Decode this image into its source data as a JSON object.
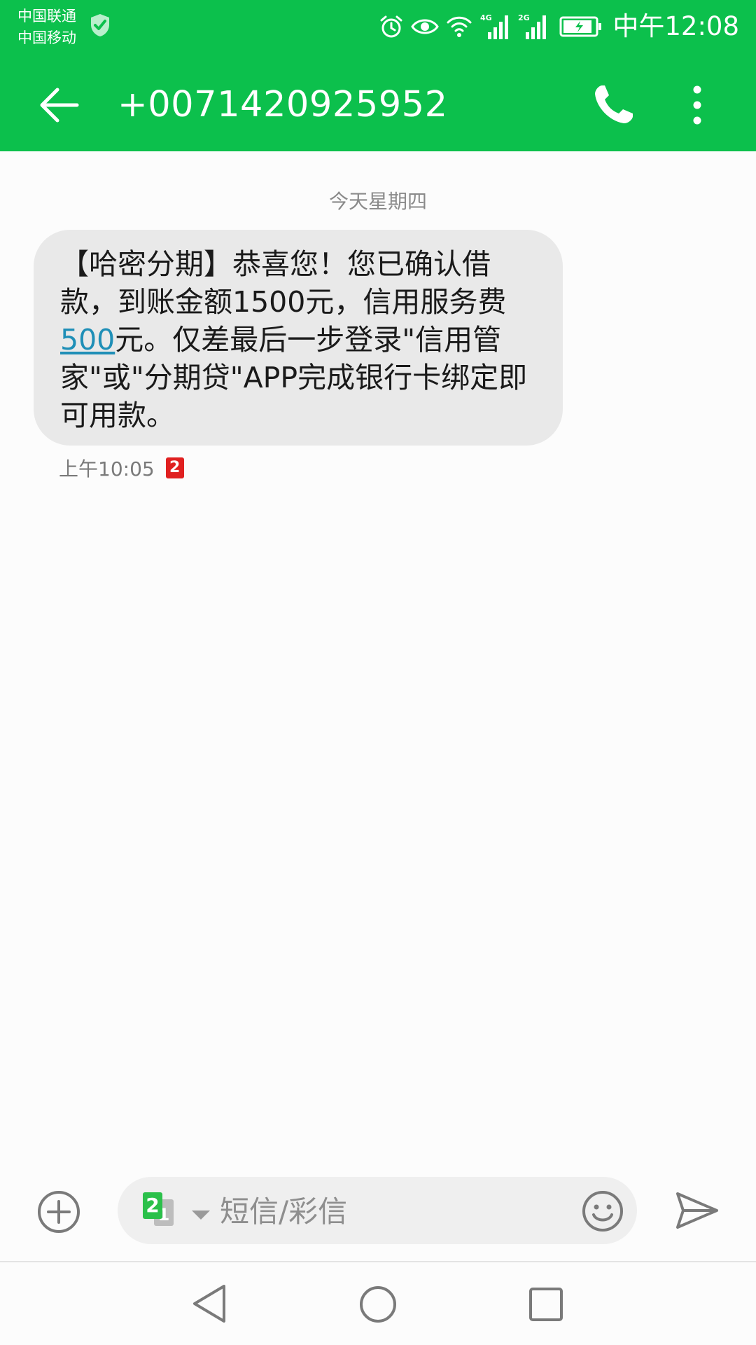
{
  "status_bar": {
    "carriers": [
      "中国联通",
      "中国移动"
    ],
    "network_labels": [
      "4G",
      "2G"
    ],
    "time": "中午12:08",
    "icons": [
      "shield-check-icon",
      "alarm-icon",
      "eye-icon",
      "wifi-icon",
      "signal-icon",
      "signal-icon",
      "battery-charging-icon"
    ]
  },
  "app_bar": {
    "title": "+0071420925952",
    "icons": [
      "back-arrow-icon",
      "phone-icon",
      "more-vertical-icon"
    ]
  },
  "conversation": {
    "date_separator": "今天星期四",
    "messages": [
      {
        "text_before_link": "【哈密分期】恭喜您！您已确认借款，到账金额1500元，信用服务费",
        "link_text": "500",
        "text_after_link": "元。仅差最后一步登录\"信用管家\"或\"分期贷\"APP完成银行卡绑定即可用款。",
        "time": "上午10:05",
        "sim_badge": "2"
      }
    ]
  },
  "compose": {
    "placeholder": "短信/彩信",
    "sim_front": "2",
    "sim_back": "1",
    "icons": [
      "add-circle-icon",
      "sim-select-icon",
      "emoji-icon",
      "send-icon"
    ]
  },
  "nav_bar": {
    "icons": [
      "nav-back-icon",
      "nav-home-icon",
      "nav-recent-icon"
    ]
  },
  "colors": {
    "accent": "#0cc04c",
    "bubble": "#e9e9e9",
    "link": "#1f8fb7",
    "sim_badge": "#e02020"
  }
}
